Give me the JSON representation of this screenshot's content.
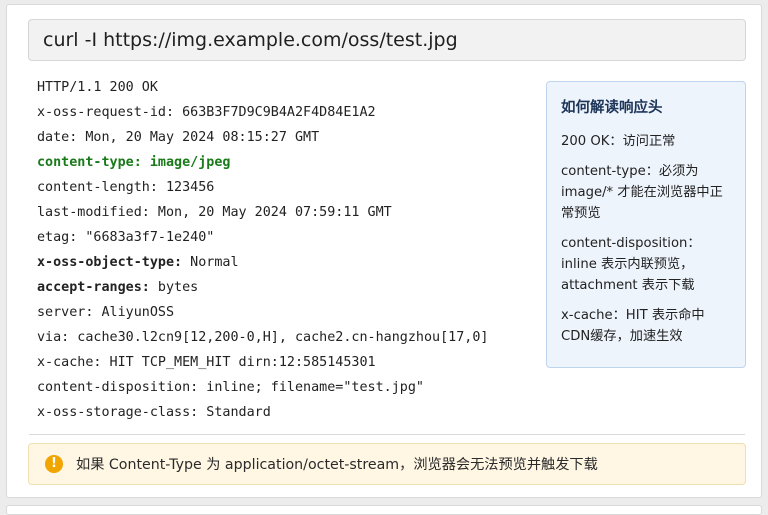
{
  "command": "curl -I https://img.example.com/oss/test.jpg",
  "headers": [
    {
      "key": "HTTP/1.1 200 OK",
      "value": "",
      "bold": false
    },
    {
      "key": "x-oss-request-id:",
      "value": " 663B3F7D9C9B4A2F4D84E1A2",
      "bold": false
    },
    {
      "key": "date:",
      "value": " Mon, 20 May 2024 08:15:27 GMT",
      "bold": false
    },
    {
      "key": "content-type:",
      "value": " image/jpeg",
      "bold": true,
      "highlight": "#1a7a1a"
    },
    {
      "key": "content-length:",
      "value": " 123456",
      "bold": false
    },
    {
      "key": "last-modified:",
      "value": " Mon, 20 May 2024 07:59:11 GMT",
      "bold": false
    },
    {
      "key": "etag:",
      "value": " \"6683a3f7-1e240\"",
      "bold": false
    },
    {
      "key": "x-oss-object-type:",
      "value": " Normal",
      "bold": true
    },
    {
      "key": "accept-ranges:",
      "value": " bytes",
      "bold": true
    },
    {
      "key": "server:",
      "value": " AliyunOSS",
      "bold": false
    },
    {
      "key": "via:",
      "value": " cache30.l2cn9[12,200-0,H], cache2.cn-hangzhou[17,0]",
      "bold": false
    },
    {
      "key": "x-cache:",
      "value": " HIT TCP_MEM_HIT dirn:12:585145301",
      "bold": false
    },
    {
      "key": "content-disposition:",
      "value": " inline; filename=\"test.jpg\"",
      "bold": false
    },
    {
      "key": "x-oss-storage-class:",
      "value": " Standard",
      "bold": false
    }
  ],
  "sidebar": {
    "title": "如何解读响应头",
    "items": [
      "200 OK：访问正常",
      "content-type：必须为 image/* 才能在浏览器中正常预览",
      "content-disposition：inline 表示内联预览，attachment 表示下载",
      "x-cache：HIT 表示命中 CDN缓存，加速生效"
    ]
  },
  "warning": {
    "icon": "exclamation-circle-icon",
    "glyph": "!",
    "text": "如果 Content-Type 为 application/octet-stream，浏览器会无法预览并触发下载"
  }
}
